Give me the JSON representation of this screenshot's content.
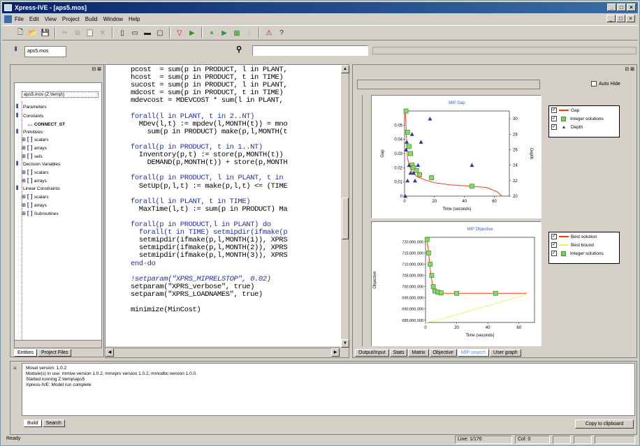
{
  "window": {
    "title": "Xpress-IVE - [aps5.mos]"
  },
  "menu": [
    "File",
    "Edit",
    "View",
    "Project",
    "Build",
    "Window",
    "Help"
  ],
  "toolbar_icons": [
    "new-icon",
    "open-icon",
    "save-icon",
    "cut-icon",
    "copy-icon",
    "paste-icon",
    "delete-icon",
    "object-icon",
    "minimize-icon",
    "restore-icon",
    "window-icon",
    "run-icon",
    "pause-icon",
    "stop-icon",
    "step-icon",
    "matrix-icon",
    "debug-icon",
    "alert-icon",
    "help-icon"
  ],
  "file_tab": "aps5.mos",
  "left_panel": {
    "file_label": "aps5.mos  (Z:\\temp\\)",
    "items": [
      {
        "label": "Parameters",
        "indent": 0
      },
      {
        "label": "Constants",
        "indent": 0
      },
      {
        "label": "CONNECT_ST",
        "indent": 2
      },
      {
        "label": "Primitives",
        "indent": 0
      },
      {
        "label": "scalars",
        "indent": 1
      },
      {
        "label": "arrays",
        "indent": 1
      },
      {
        "label": "sets",
        "indent": 1
      },
      {
        "label": "Decision Variables",
        "indent": 0
      },
      {
        "label": "scalars",
        "indent": 1
      },
      {
        "label": "arrays",
        "indent": 1
      },
      {
        "label": "Linear Constraints",
        "indent": 0
      },
      {
        "label": "scalars",
        "indent": 1
      },
      {
        "label": "arrays",
        "indent": 1
      },
      {
        "label": "Subroutines",
        "indent": 1
      }
    ],
    "tabs": [
      "Entities",
      "Project Files"
    ]
  },
  "code": [
    "pcost  = sum(p in PRODUCT, l in PLANT,",
    "hcost  = sum(p in PRODUCT, t in TIME)",
    "sucost = sum(p in PRODUCT, l in PLANT,",
    "mdcost = sum(p in PRODUCT, t in TIME)",
    "mdevcost = MDEVCOST * sum(l in PLANT,",
    "",
    "forall(l in PLANT, t in 2..NT)",
    "  MDev(l,t) := mpdev(l,MONTH(t)) = mno",
    "    sum(p in PRODUCT) make(p,l,MONTH(t",
    "",
    "forall(p in PRODUCT, t in 1..NT)",
    "  Inventory(p,t) := store(p,MONTH(t))",
    "    DEMAND(p,MONTH(t)) + store(p,MONTH",
    "",
    "forall(p in PRODUCT, l in PLANT, t in",
    "  SetUp(p,l,t) := make(p,l,t) <= (TIME",
    "",
    "forall(l in PLANT, t in TIME)",
    "  MaxTime(l,t) := sum(p in PRODUCT) Ma",
    "",
    "forall(p in PRODUCT,l in PLANT) do",
    "  forall(t in TIME) setmipdir(ifmake(p",
    "  setmipdir(ifmake(p,l,MONTH(1)), XPRS",
    "  setmipdir(ifmake(p,l,MONTH(2)), XPRS",
    "  setmipdir(ifmake(p,l,MONTH(3)), XPRS",
    "end-do",
    "",
    "!setparam(\"XPRS_MIPRELSTOP\", 0.02)",
    "setparam(\"XPRS_verbose\", true)",
    "setparam(\"XPRS_LOADNAMES\", true)",
    "",
    "minimize(MinCost)"
  ],
  "right_panel": {
    "auto_hide_label": "Auto Hide",
    "tabs": [
      "Output/Input",
      "Stats",
      "Matrix",
      "Objective",
      "MIP search",
      "User graph"
    ],
    "active_tab": "MIP search"
  },
  "chart_data": [
    {
      "type": "line",
      "title": "MIP Gap",
      "xlabel": "Time (seconds)",
      "ylabel": "Gap",
      "y2label": "Depth",
      "xlim": [
        0,
        70
      ],
      "ylim": [
        0,
        0.06
      ],
      "y2lim": [
        20,
        31
      ],
      "x_ticks": [
        "0",
        "20",
        "40",
        "60"
      ],
      "y_ticks": [
        "0",
        "0.01",
        "0.02",
        "0.03",
        "0.04",
        "0.05"
      ],
      "y2_ticks": [
        "20",
        "22",
        "24",
        "26",
        "28",
        "30"
      ],
      "legend": [
        "Gap",
        "Integer solutions",
        "Depth"
      ],
      "series": [
        {
          "name": "Gap",
          "color": "#ff3a00",
          "x": [
            0.5,
            1,
            1.5,
            2,
            3,
            4,
            5,
            6,
            8,
            10,
            15,
            20,
            30,
            45,
            55,
            62,
            65
          ],
          "y": [
            0.06,
            0.05,
            0.035,
            0.027,
            0.022,
            0.019,
            0.017,
            0.016,
            0.014,
            0.013,
            0.011,
            0.0095,
            0.008,
            0.007,
            0.006,
            0.003,
            0.0
          ]
        },
        {
          "name": "Integer solutions",
          "color": "#3a9a2a",
          "x": [
            1,
            2,
            3,
            4,
            5,
            6,
            8,
            10,
            18,
            45
          ],
          "y": [
            0.06,
            0.045,
            0.035,
            0.03,
            0.022,
            0.02,
            0.018,
            0.015,
            0.013,
            0.007
          ]
        },
        {
          "name": "Depth",
          "color": "#2a3a9a",
          "axis": "y2",
          "x": [
            0.5,
            1,
            1.5,
            2,
            3,
            4,
            5,
            6,
            7,
            9,
            11,
            17,
            45
          ],
          "y": [
            20,
            26,
            27,
            22,
            24,
            23,
            28,
            23,
            22,
            24,
            27,
            30,
            24
          ]
        }
      ]
    },
    {
      "type": "line",
      "title": "MIP Objective",
      "xlabel": "Time (seconds)",
      "ylabel": "Objective",
      "xlim": [
        0,
        70
      ],
      "ylim": [
        684000000,
        722000000
      ],
      "x_ticks": [
        "0",
        "20",
        "40",
        "60"
      ],
      "y_ticks": [
        "685,000,000",
        "690,000,000",
        "695,000,000",
        "700,000,000",
        "705,000,000",
        "710,000,000",
        "715,000,000",
        "720,000,000"
      ],
      "legend": [
        "Best solution",
        "Best bound",
        "Integer solutions"
      ],
      "series": [
        {
          "name": "Best solution",
          "color": "#ff3a00",
          "x": [
            1,
            2,
            3,
            4,
            5,
            6,
            8,
            10,
            20,
            45,
            65
          ],
          "y": [
            721000000,
            715000000,
            708000000,
            703000000,
            699000000,
            697500000,
            697000000,
            697000000,
            697000000,
            697000000,
            697000000
          ]
        },
        {
          "name": "Best bound",
          "color": "#f0f060",
          "x": [
            0,
            5,
            10,
            20,
            30,
            40,
            50,
            60,
            65
          ],
          "y": [
            684000000,
            684500000,
            685500000,
            687500000,
            689500000,
            691500000,
            693500000,
            695500000,
            696500000
          ]
        },
        {
          "name": "Integer solutions",
          "color": "#3a9a2a",
          "x": [
            1,
            2,
            3,
            4,
            5,
            6,
            8,
            10,
            20,
            45
          ],
          "y": [
            721000000,
            715000000,
            710000000,
            705000000,
            700000000,
            698000000,
            697500000,
            697200000,
            697000000,
            697000000
          ]
        }
      ]
    }
  ],
  "output": {
    "lines": [
      "Mosel version: 1.0.2",
      "Module(s) in use: mmive version 1.0.2, mmxprs version 1.0.2, mmodbc version 1.0.0.",
      "Started running Z:\\temp\\aps5",
      "Xpress-IVE: Model run complete"
    ],
    "tabs": [
      "Build",
      "Search"
    ],
    "copy_button": "Copy to clipboard"
  },
  "status": {
    "left": "Ready",
    "line": "Line: 1/176",
    "col": "Col: 0"
  }
}
